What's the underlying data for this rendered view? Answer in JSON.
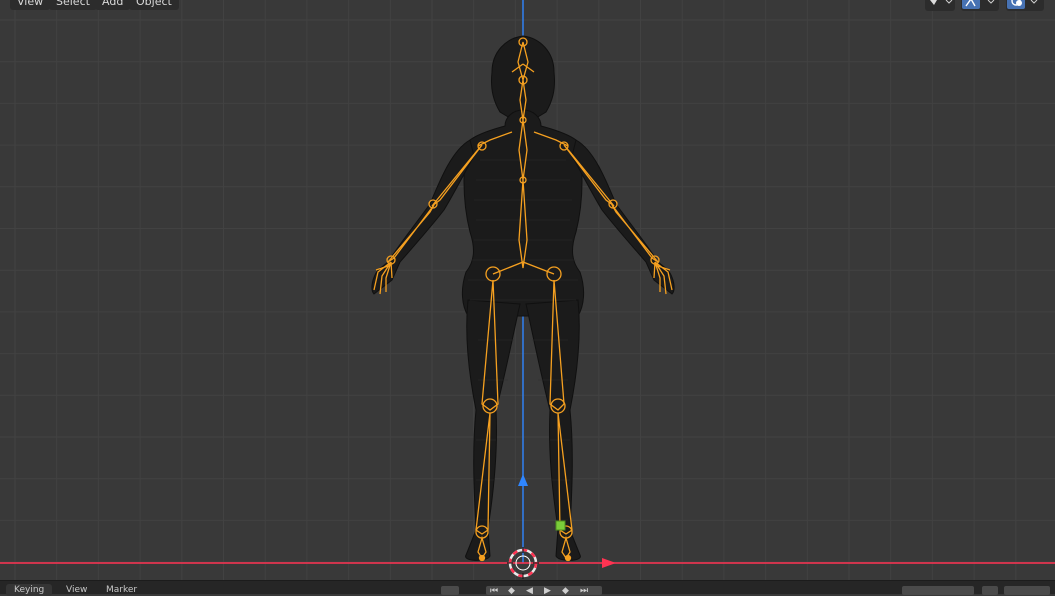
{
  "header": {
    "menus": [
      {
        "id": "view",
        "label": "View"
      },
      {
        "id": "select",
        "label": "Select"
      },
      {
        "id": "add",
        "label": "Add"
      },
      {
        "id": "object",
        "label": "Object"
      }
    ],
    "right_tools": [
      {
        "icon": "pivot-point-icon"
      },
      {
        "icon": "snap-icon"
      },
      {
        "icon": "viewport-overlays-icon"
      }
    ]
  },
  "viewport": {
    "object": "armature-rigged-character-mesh",
    "axis_colors": {
      "x": "#ff3352",
      "z": "#2f86ff"
    },
    "bone_color": "#f5a020",
    "mesh_color": "#1a1a1a"
  },
  "timeline": {
    "left_labels": [
      "Keying",
      "View",
      "Marker"
    ],
    "playback_icons": [
      "jump-start-icon",
      "prev-keyframe-icon",
      "play-reverse-icon",
      "play-icon",
      "next-keyframe-icon",
      "jump-end-icon"
    ]
  },
  "colors": {
    "background": "#393939",
    "grid": "#424242",
    "header": "#2c2c2c",
    "active_blue": "#4772b3"
  }
}
